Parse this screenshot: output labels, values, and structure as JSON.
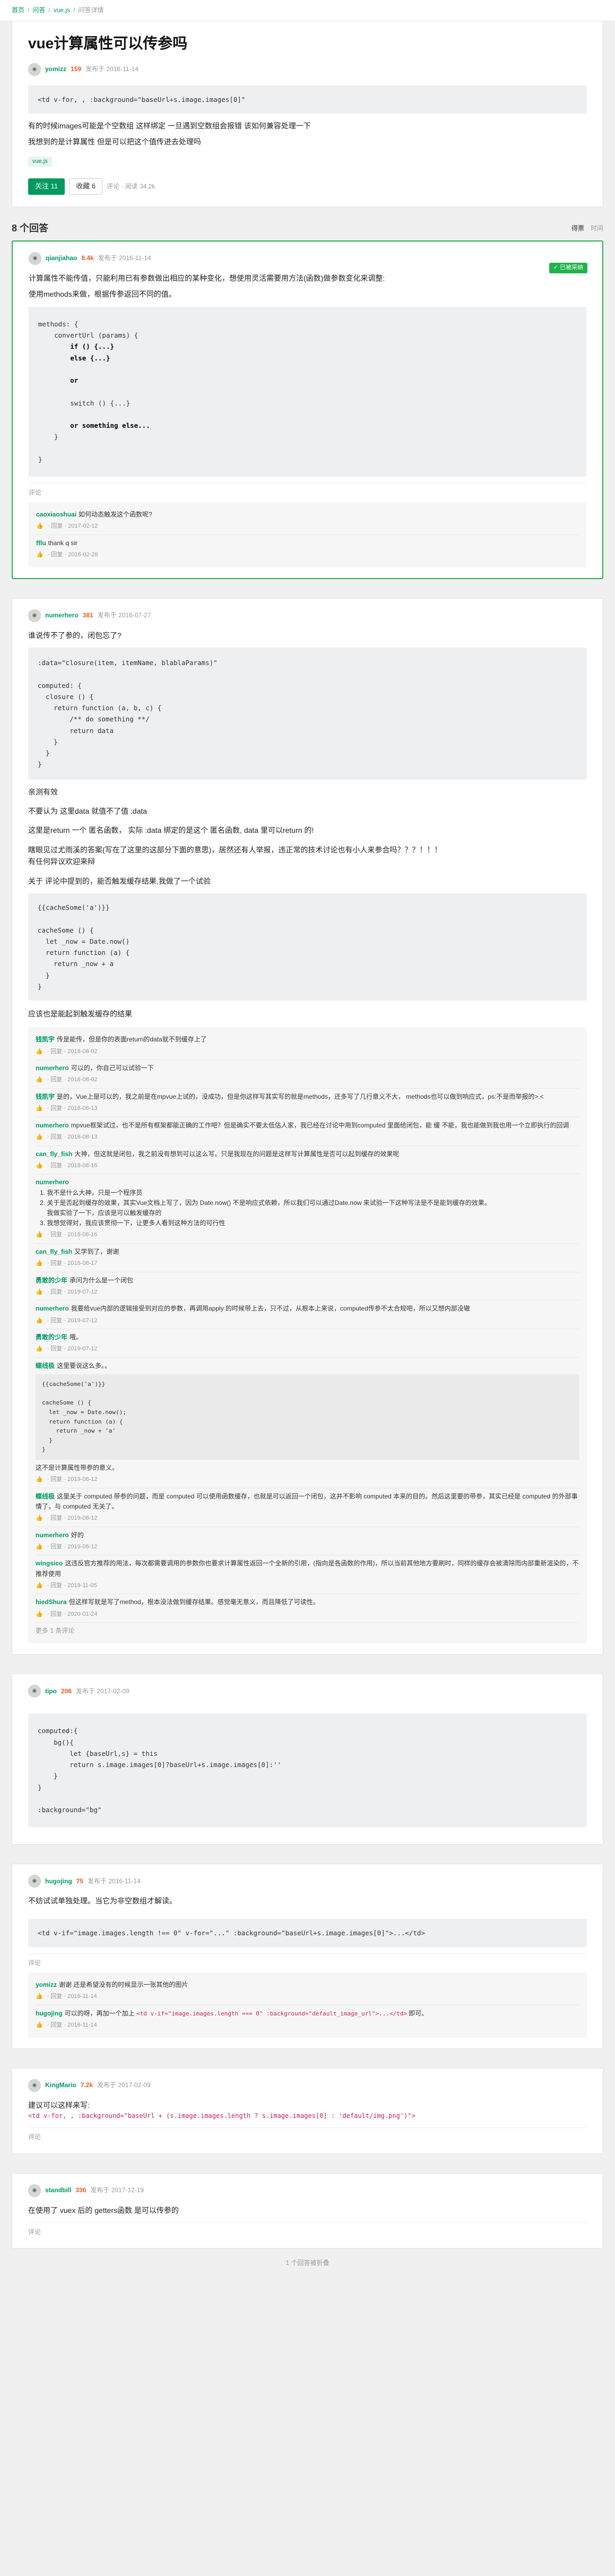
{
  "breadcrumb": {
    "items": [
      "首页",
      "问答",
      "vue.js",
      "问答详情"
    ],
    "sep": "/"
  },
  "question": {
    "title": "vue计算属性可以传参吗",
    "author": "yomizz",
    "rep": "159",
    "time": "发布于 2016-11-14",
    "code": "<td v-for, , :background=\"baseUrl+s.image.images[0]\"",
    "p1": "有的时候images可能是个空数组 这样绑定 一旦遇到空数组会报错 该如何兼容处理一下",
    "p2": "我想到的是计算属性 但是可以把这个值传进去处理吗",
    "tag": "vue.js",
    "follow": "关注 11",
    "collect": "收藏 6",
    "stat": "评论 · 阅读 34.2k"
  },
  "answers_header": {
    "count": "8 个回答",
    "sort_vote": "得票",
    "sort_time": "时间"
  },
  "ans1": {
    "author": "qianjiahao",
    "rep": "8.4k",
    "time": "发布于 2016-11-14",
    "accepted": "✓ 已被采纳",
    "p1": "计算属性不能传值，只能利用已有参数做出相应的某种变化，想使用灵活需要用方法(函数)做参数变化来调整:",
    "p2": "使用methods来做，根据传参返回不同的值。",
    "code_l1": "methods: {",
    "code_l2": "    convertUrl (params) {",
    "code_l3": "        if () {...}",
    "code_l4": "        else {...}",
    "code_l5": "        or",
    "code_l6": "        switch () {...}",
    "code_l7": "        or something else...",
    "code_l8": "    }",
    "code_l9": "}",
    "comment_link": "评论",
    "c1_n": "caoxiaoshuai",
    "c1_t": "如何动态触发这个函数呢?",
    "c1_m": "· 回复 · 2017-02-12",
    "c2_n": "fflu",
    "c2_t": "thank q sir",
    "c2_m": "· 回复 · 2016-02-28"
  },
  "ans2": {
    "author": "numerhero",
    "rep": "381",
    "time": "发布于 2016-07-27",
    "p1": "谁说传不了参的，闭包忘了?",
    "code1": ":data=\"closure(item, itemName, blablaParams)\"\n\ncomputed: {\n  closure () {\n    return function (a, b, c) {\n        /** do something **/\n        return data\n    }\n  }\n}",
    "p2": "亲测有效",
    "p3": "不要认为 这里data 就值不了值 :data",
    "p4": "这里是return 一个 匿名函数， 实际 :data 绑定的是这个 匿名函数, data 里可以return 的!",
    "p5": "瞎眼见过尤雨溪的答案(写在了这里的这部分下面的意思)，居然还有人举报，违正常的技术讨论也有小人来参合吗？？？！！！",
    "p6": "有任何异议欢迎来辩",
    "p7": "关于 评论中提到的，能否触发缓存结果,我做了一个试验",
    "code2": "{{cacheSome('a')}}\n\ncacheSome () {\n  let _now = Date.now()\n  return function (a) {\n    return _now + a\n  }\n}",
    "p8": "应该也是能起到触发缓存的结果",
    "comments": [
      {
        "n": "钱凯宇",
        "t": "传是能传，但是你的表面return的data就不到缓存上了",
        "m": "· 回复 · 2018-08-02"
      },
      {
        "n": "numerhero",
        "t": "可以的，你自己可以试验一下",
        "m": "· 回复 · 2018-08-02"
      },
      {
        "n": "钱凯宇",
        "t": "是的，Vue上是可以的，我之前是在mpvue上试的，没成功，但是你这样写其实写的就是methods，还多写了几行意义不大， methods也可以做到响应式，ps:不是而举报的>.<",
        "m": "· 回复 · 2018-08-13"
      },
      {
        "n": "numerhero",
        "t": "mpvue框架试过，也不是所有框架都能正确的工作吧？但是确实不要太低估人家，我已经在讨论中用到computed 里面给闭包，能 缓 不能，我也能做到我也用一个立即执行的回调",
        "m": "· 回复 · 2018-08-13"
      },
      {
        "n": "can_fly_fish",
        "t": "大神，但这就是闭包，我之前没有想到可以这么写。只是我现在的问题是这样写计算属性是否可以起到缓存的效果呢",
        "m": "· 回复 · 2018-08-16"
      }
    ],
    "c6_n": "numerhero",
    "c6_list": [
      "1. 我不是什么大神，只是一个程序员",
      "2. 关于是否起到缓存的效果，其实Vue文档上写了，因为 Date.now() 不是响应式依赖，所以我们可以通过Date.now 来试验一下这种写法是不是能到缓存的效果。",
      "    我做实验了一下，应该是可以触发缓存的",
      "3. 我想觉得对，我应该贯彻一下，让更多人看到这种方法的可行性"
    ],
    "c6_m": "· 回复 · 2018-08-16",
    "c7_n": "can_fly_fish",
    "c7_t": "又学到了，谢谢",
    "c7_m": "· 回复 · 2018-08-17",
    "c8_n": "勇敢的少年",
    "c8_t": "承问为什么是一个闭包",
    "c8_m": "· 回复 · 2019-07-12",
    "c9_n": "numerhero",
    "c9_t": "我要给vue内部的逻辑接受到对应的参数，再调用apply 的时候带上去，只不过，从根本上来说，computed传参不太合规吧，所以又想内部没辙",
    "c9_m": "· 回复 · 2019-07-12",
    "c10_n": "勇敢的少年",
    "c10_t": "哦。",
    "c10_m": "· 回复 · 2019-07-12",
    "c11_n": "蝶线极",
    "c11_t": "这里要说这么多。。",
    "c11_code": "{{cacheSome('a')}}\n\ncacheSome () {\n  let _now = Date.now();\n  return function (a) {\n    return _now + 'a'\n  }\n}",
    "c11_t2": "这不是计算属性带参的意义。",
    "c11_m": "· 回复 · 2019-08-12",
    "c12_n": "蝶线极",
    "c12_t": "这里关于 computed 带参的问题，而是 computed 可以使用函数缓存，也就是可以返回一个闭包，这并不影响 computed 本来的目的。然后这里要的带参，其实已经是 computed 的外部事情了，与 computed 无关了。",
    "c12_m": "· 回复 · 2019-08-12",
    "c13_n": "numerhero",
    "c13_t": "好的",
    "c13_m": "· 回复 · 2019-08-12",
    "c14_n": "wingsico",
    "c14_t": "这违反官方推荐的用法，每次都需要调用的参数你也要求计算属性返回一个全新的引用，(指向是各函数的作用)，所以当前其他地方要刷时，同样的缓存会被清除而内部重新渲染的，不推荐使用",
    "c14_m": "· 回复 · 2019-11-05",
    "c15_n": "hiedShura",
    "c15_t": "但这样写就是写了method，根本没法做到缓存结果。感觉毫无意义，而且降低了可读性。",
    "c15_m": "· 回复 · 2020-01-24",
    "more": "更多 1 条评论"
  },
  "ans3": {
    "author": "tipo",
    "rep": "206",
    "time": "发布于 2017-02-09",
    "code": "computed:{\n    bg(){\n        let {baseUrl,s} = this\n        return s.image.images[0]?baseUrl+s.image.images[0]:''\n    }\n}\n\n:background=\"bg\""
  },
  "ans4": {
    "author": "hugojing",
    "rep": "75",
    "time": "发布于 2016-11-14",
    "p1": "不妨试试单独处理。当它为非空数组才解读。",
    "code": "<td v-if=\"image.images.length !== 0\" v-for=\"...\" :background=\"baseUrl+s.image.images[0]\">...</td>",
    "comment_link": "评论",
    "c1_n": "yomizz",
    "c1_t": "谢谢 还是希望没有的时候显示一张其他的图片",
    "c1_m": "· 回复 · 2016-11-14",
    "c2_n": "hugojing",
    "c2_t": "可以的呀，再加一个加上",
    "c2_code": "<td v-if=\"image.images.length === 0\" :background=\"default_image_url\">...</td>",
    "c2_t2": "即可。",
    "c2_m": "· 回复 · 2016-11-14"
  },
  "ans5": {
    "author": "KingMario",
    "rep": "7.2k",
    "time": "发布于 2017-02-09",
    "p1": "建议可以这样来写:",
    "code": "<td v-for, , :background=\"baseUrl + (s.image.images.length ? s.image.images[0] : 'default/img.png')\">",
    "comment_link": "评论"
  },
  "ans6": {
    "author": "standbill",
    "rep": "336",
    "time": "发布于 2017-12-19",
    "p1": "在使用了 vuex 后的 getters函数 是可以传参的",
    "comment_link": "评论"
  },
  "pager": "1 个回答被折叠",
  "colors": {
    "accent": "#009a61",
    "accepted": "#22b24c",
    "reputation": "#e45d2b"
  }
}
